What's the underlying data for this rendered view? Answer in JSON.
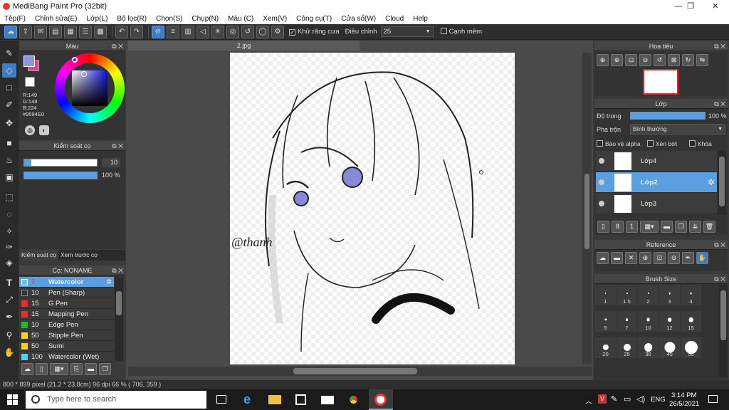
{
  "window": {
    "title": "MediBang Paint Pro (32bit)",
    "min": "—",
    "max": "❐",
    "close": "✕"
  },
  "menu": [
    "Tệp(F)",
    "Chỉnh sửa(E)",
    "Lớp(L)",
    "Bộ lọc(R)",
    "Chọn(S)",
    "Chụp(N)",
    "Màu (C)",
    "Xem(V)",
    "Công cụ(T)",
    "Cửa sổ(W)",
    "Cloud",
    "Help"
  ],
  "toolbar": {
    "antialias_label": "Khử răng cưa",
    "adjust_label": "Điều chỉnh",
    "adjust_value": "25",
    "snap_label": "Cạnh mềm"
  },
  "color_panel": {
    "title": "Màu",
    "r": "R:149",
    "g": "G:148",
    "b": "B:224",
    "hex": "#9594E0",
    "fg": "#9594E0"
  },
  "brush_control": {
    "title": "Kiểm soát cọ",
    "size_value": "10",
    "opacity_value": "100 %",
    "size_fill": 0.1,
    "opacity_fill": 1.0,
    "tab1": "Kiểm soát cọ",
    "tab2": "Xem trước cọ"
  },
  "brush_list": {
    "title": "Cọ: NONAME",
    "items": [
      {
        "size": "7",
        "name": "Watercolor",
        "color": "#5bc8f0",
        "selected": true
      },
      {
        "size": "10",
        "name": "Pen (Sharp)",
        "color": "#333333"
      },
      {
        "size": "15",
        "name": "G Pen",
        "color": "#e03030"
      },
      {
        "size": "15",
        "name": "Mapping Pen",
        "color": "#e03030"
      },
      {
        "size": "10",
        "name": "Edge Pen",
        "color": "#30b030"
      },
      {
        "size": "50",
        "name": "Stipple Pen",
        "color": "#f0d020"
      },
      {
        "size": "50",
        "name": "Sumi",
        "color": "#f0d020"
      },
      {
        "size": "100",
        "name": "Watercolor (Wet)",
        "color": "#5bc8f0"
      }
    ]
  },
  "document": {
    "tab": "2.jpg",
    "signature": "@thanh"
  },
  "navigator": {
    "title": "Hoa tiêu"
  },
  "layers": {
    "title": "Lớp",
    "opacity_label": "Độ trong",
    "opacity_value": "100 %",
    "opacity_fill": 1.0,
    "blend_label": "Pha trộn",
    "blend_value": "Bình thường",
    "protect_alpha": "Bảo vệ alpha",
    "clipping": "Xén bớt",
    "lock": "Khóa",
    "items": [
      {
        "name": "Lớp4",
        "selected": false
      },
      {
        "name": "Lớp2",
        "selected": true
      },
      {
        "name": "Lớp3",
        "selected": false
      }
    ]
  },
  "reference": {
    "title": "Reference"
  },
  "brush_size": {
    "title": "Brush Size",
    "sizes": [
      "1",
      "1.5",
      "2",
      "3",
      "4",
      "5",
      "7",
      "10",
      "12",
      "15",
      "20",
      "25",
      "30",
      "40",
      "50"
    ]
  },
  "status": {
    "text": "800 * 899 pixel  (21.2 * 23.8cm)  96 dpi  66 %  ( 706, 359 )"
  },
  "taskbar": {
    "search_placeholder": "Type here to search",
    "lang": "ENG",
    "time": "3:14 PM",
    "date": "26/5/2021"
  }
}
